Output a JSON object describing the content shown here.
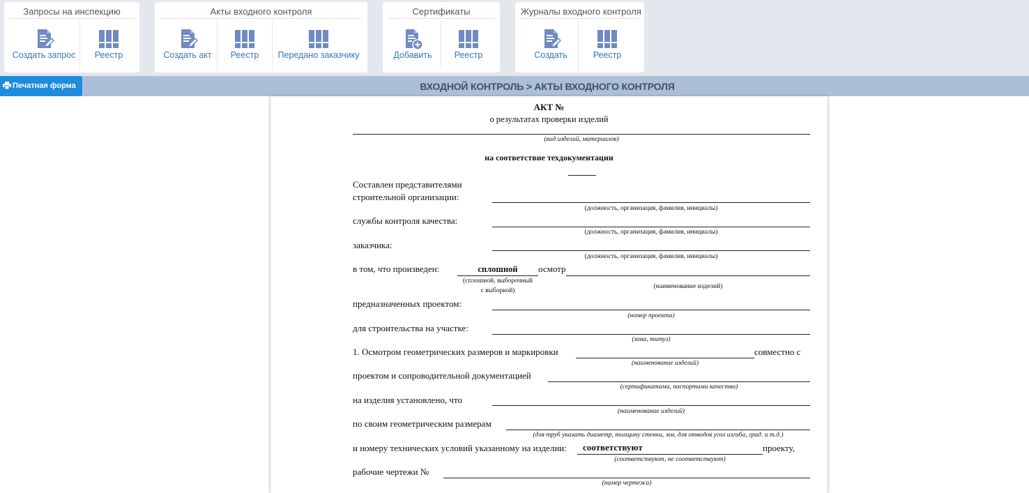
{
  "ribbon": {
    "groups": [
      {
        "title": "Запросы на инспекцию",
        "buttons": [
          {
            "label": "Создать запрос",
            "icon": "edit-document-icon"
          },
          {
            "label": "Реестр",
            "icon": "registry-icon"
          }
        ]
      },
      {
        "title": "Акты входного контроля",
        "buttons": [
          {
            "label": "Создать акт",
            "icon": "edit-document-icon"
          },
          {
            "label": "Реестр",
            "icon": "registry-icon"
          },
          {
            "label": "Передано заказчику",
            "icon": "registry-icon"
          }
        ]
      },
      {
        "title": "Сертификаты",
        "buttons": [
          {
            "label": "Добавить",
            "icon": "add-document-icon"
          },
          {
            "label": "Реестр",
            "icon": "registry-icon"
          }
        ]
      },
      {
        "title": "Журналы входного контроля",
        "buttons": [
          {
            "label": "Создать",
            "icon": "edit-document-icon"
          },
          {
            "label": "Реестр",
            "icon": "registry-icon"
          }
        ]
      }
    ],
    "icon_color": "#6f8ac4"
  },
  "toolbar": {
    "print_label": "Печатная форма",
    "page_title": "ВХОДНОЙ КОНТРОЛЬ > АКТЫ ВХОДНОГО КОНТРОЛЯ",
    "accent": "#1f8bdc"
  },
  "document": {
    "title": "АКТ №",
    "subtitle": "о результатах проверки изделий",
    "subtitle_caption": "(вид изделий, материалов)",
    "heading": "на соответствие техдокументации",
    "composed_by": "Составлен представителями",
    "construction_org": "строительной организации:",
    "person_caption": "(должность, организация, фамилия, инициалы)",
    "quality_service": "службы контроля качества:",
    "customer": "заказчика:",
    "inspection_intro": "в том, что произведен:",
    "inspection_value": "сплошной",
    "inspection_word": "осмотр",
    "inspection_caption_1": "(сплошной, выборочный",
    "inspection_caption_2": "с выборкой)",
    "item_name_caption": "(наименование изделий)",
    "intended_project": "предназначенных проектом:",
    "project_caption": "(номер проекта)",
    "site": "для строительства на участке:",
    "site_caption": "(зона, титул)",
    "p1": "1. Осмотром геометрических размеров и маркировки",
    "p1_tail": "совместно с",
    "p1_caption": "(наименование изделий)",
    "p2": "проектом и сопроводительной документацией",
    "p2_caption": "(сертификатами, паспортами качества)",
    "p3": "на изделия установлено, что",
    "p3_caption": "(наименование изделий)",
    "p4": "по своим геометрическим размерам",
    "p4_caption": "(для труб указать диаметр, толщину стенки, мм, для отводов угол изгиба, град. и т.д.)",
    "p5": "и номеру технических условий указанному на изделии:",
    "p5_value": "соответствуют",
    "p5_tail": "проекту,",
    "p5_caption": "(соответствуют, не соответствуют)",
    "p6": "рабочие чертежи №",
    "p6_caption": "(намер чертежа)"
  }
}
